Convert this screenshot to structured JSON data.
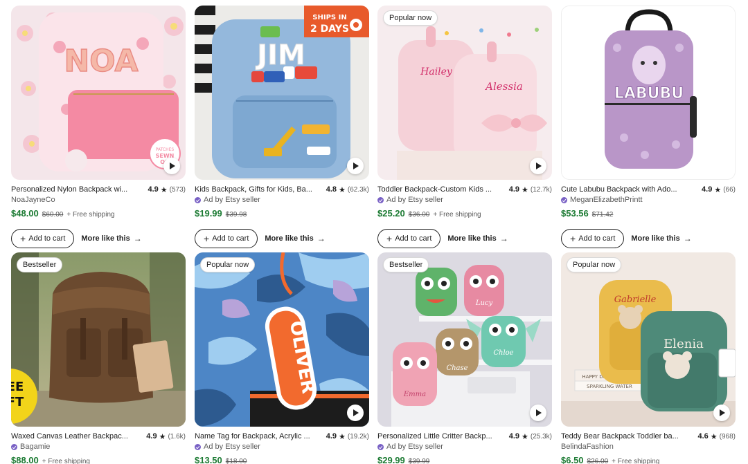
{
  "products": [
    {
      "title": "Personalized Nylon Backpack wi...",
      "rating": "4.9",
      "reviews": "(573)",
      "seller": "NoaJayneCo",
      "ad": false,
      "price": "$48.00",
      "original_price": "$60.00",
      "shipping": "+ Free shipping",
      "badge": "",
      "image_text": "NOA",
      "patch_text": "PATCHES SEWN ON",
      "has_video": true,
      "add_to_cart": "Add to cart",
      "more_like_this": "More like this",
      "colors": {
        "bg": "#f2dde4",
        "bag": "#f7c8d4",
        "pocket": "#f58aa3"
      }
    },
    {
      "title": "Kids Backpack, Gifts for Kids, Ba...",
      "rating": "4.8",
      "reviews": "(62.3k)",
      "seller": "Ad by Etsy seller",
      "ad": true,
      "price": "$19.99",
      "original_price": "$39.98",
      "shipping": "",
      "badge": "",
      "image_text": "JIM",
      "corner_text": "SHIPS IN 2 DAYS",
      "has_video": true,
      "add_to_cart": "Add to cart",
      "more_like_this": "More like this",
      "colors": {
        "bg": "#e9e5df",
        "bag": "#8fb4d9",
        "pocket": "#7aa3cc"
      }
    },
    {
      "title": "Toddler Backpack-Custom Kids ...",
      "rating": "4.9",
      "reviews": "(12.7k)",
      "seller": "Ad by Etsy seller",
      "ad": true,
      "price": "$25.20",
      "original_price": "$36.00",
      "shipping": "+ Free shipping",
      "badge": "Popular now",
      "image_text_1": "Hailey",
      "image_text_2": "Alessia",
      "has_video": true,
      "add_to_cart": "Add to cart",
      "more_like_this": "More like this",
      "colors": {
        "bg": "#f5e9ea",
        "bag": "#f5cfd6",
        "pocket": "#f1bcc6"
      }
    },
    {
      "title": "Cute Labubu Backpack with Ado...",
      "rating": "4.9",
      "reviews": "(66)",
      "seller": "MeganElizabethPrintt",
      "ad": false,
      "price": "$53.56",
      "original_price": "$71.42",
      "shipping": "",
      "badge": "",
      "image_text": "LABUBU",
      "has_video": false,
      "add_to_cart": "Add to cart",
      "more_like_this": "More like this",
      "colors": {
        "bg": "#ffffff",
        "bag": "#b48fc4",
        "pocket": "#a07bb3"
      }
    },
    {
      "title": "Waxed Canvas Leather Backpac...",
      "rating": "4.9",
      "reviews": "(1.6k)",
      "seller": "Bagamie",
      "ad": false,
      "star_seller": true,
      "price": "$88.00",
      "original_price": "",
      "shipping": "+ Free shipping",
      "badge": "Bestseller",
      "corner_text": "EE FT",
      "has_video": false,
      "colors": {
        "bg": "#5e6b48",
        "bag": "#6b4a30",
        "pocket": "#5a3c26"
      }
    },
    {
      "title": "Name Tag for Backpack, Acrylic ...",
      "rating": "4.9",
      "reviews": "(19.2k)",
      "seller": "Ad by Etsy seller",
      "ad": true,
      "price": "$13.50",
      "original_price": "$18.00",
      "shipping": "",
      "badge": "Popular now",
      "image_text": "OLIVER",
      "has_video": true,
      "colors": {
        "bg": "#4a84c4",
        "bag": "#7fb2e5",
        "pocket": "#f26a2e"
      }
    },
    {
      "title": "Personalized Little Critter Backp...",
      "rating": "4.9",
      "reviews": "(25.3k)",
      "seller": "Ad by Etsy seller",
      "ad": true,
      "price": "$29.99",
      "original_price": "$39.99",
      "shipping": "",
      "badge": "Bestseller",
      "image_text_1": "Lucy",
      "image_text_2": "Chloe",
      "image_text_3": "Chase",
      "image_text_4": "Emma",
      "has_video": true,
      "colors": {
        "bg": "#dedbe3",
        "bag": "#5fb36a",
        "pocket": "#e87b8e"
      }
    },
    {
      "title": "Teddy Bear Backpack Toddler ba...",
      "rating": "4.6",
      "reviews": "(968)",
      "seller": "BelindaFashion",
      "ad": false,
      "price": "$6.50",
      "original_price": "$26.00",
      "shipping": "+ Free shipping",
      "badge": "Popular now",
      "image_text_1": "Gabrielle",
      "image_text_2": "Elenia",
      "book_text_1": "HAPPY DREAM WORLD",
      "book_text_2": "SPARKLING WATER",
      "has_video": true,
      "colors": {
        "bg": "#efe7e1",
        "bag": "#e6b94a",
        "pocket": "#4f8a7a"
      }
    }
  ]
}
